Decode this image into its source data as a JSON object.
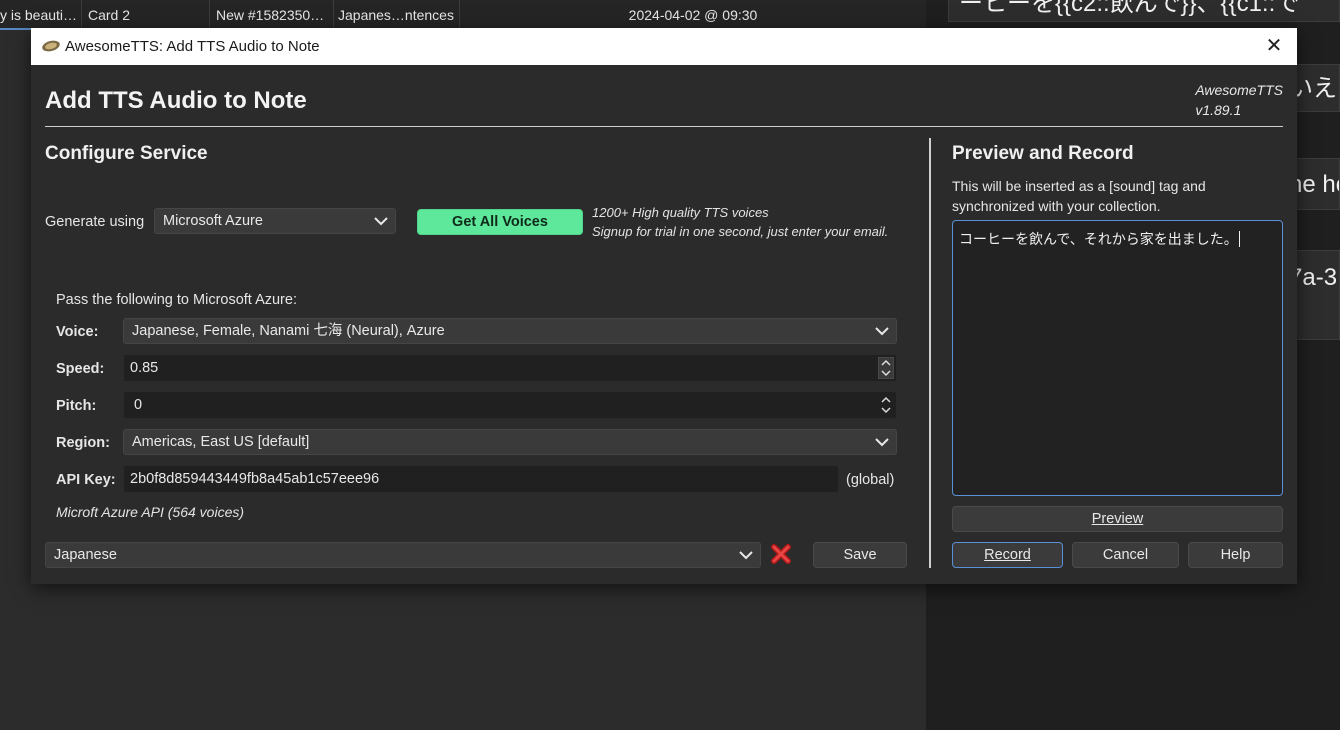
{
  "background": {
    "row_cells": [
      "y is beauti…",
      "Card 2",
      "New #1582350…",
      "Japanes…ntences",
      "2024-04-02 @ 09:30"
    ],
    "right_fields": [
      "ーヒーを{{c2::飲んで}}、{{c1::で",
      "いえそ",
      "he ho",
      "7a-3"
    ]
  },
  "dialog": {
    "window_title": "AwesomeTTS: Add TTS Audio to Note",
    "heading": "Add TTS Audio to Note",
    "version_name": "AwesomeTTS",
    "version_num": "v1.89.1",
    "configure": {
      "heading": "Configure Service",
      "generate_label": "Generate using",
      "service": "Microsoft Azure",
      "get_voices_btn": "Get All Voices",
      "promo_line1": "1200+ High quality TTS voices",
      "promo_line2": "Signup for trial in one second, just enter your email.",
      "pass_label": "Pass the following to Microsoft Azure:",
      "voice_label": "Voice:",
      "voice_value": "Japanese, Female, Nanami 七海 (Neural), Azure",
      "speed_label": "Speed:",
      "speed_value": "0.85",
      "pitch_label": "Pitch:",
      "pitch_value": "0",
      "region_label": "Region:",
      "region_value": "Americas, East US [default]",
      "apikey_label": "API Key:",
      "apikey_value": "2b0f8d859443449fb8a45ab1c57eee96",
      "apikey_scope": "(global)",
      "api_note": "Microft Azure API (564 voices)",
      "preset_value": "Japanese",
      "save_btn": "Save"
    },
    "preview": {
      "heading": "Preview and Record",
      "desc_line1": "This will be inserted as a [sound] tag and",
      "desc_line2": "synchronized with your collection.",
      "text": "コーヒーを飲んで、それから家を出ました。",
      "preview_btn": "Preview",
      "record_btn": "Record",
      "cancel_btn": "Cancel",
      "help_btn": "Help"
    }
  }
}
